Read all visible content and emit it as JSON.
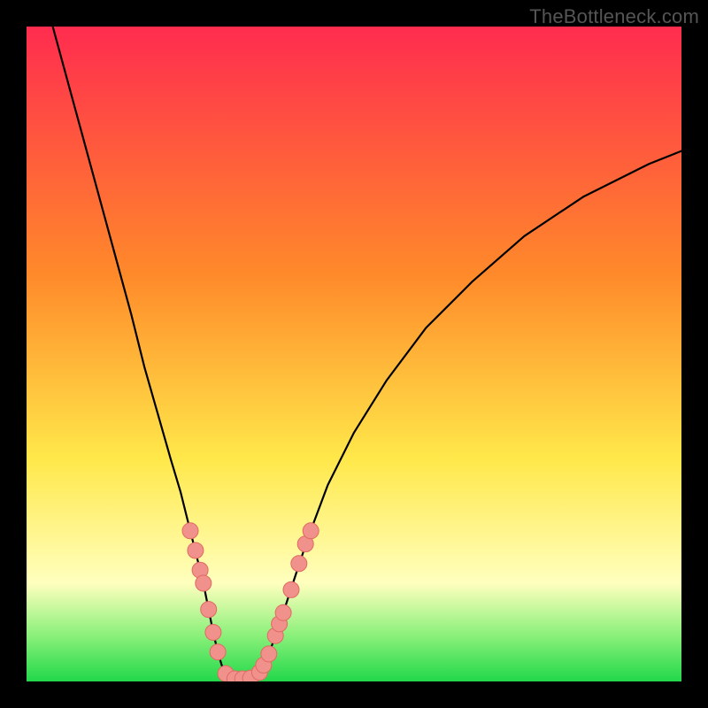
{
  "watermark": "TheBottleneck.com",
  "colors": {
    "gradient_top": "#FF2C4F",
    "gradient_mid1": "#FF8A2A",
    "gradient_mid2": "#FFE84A",
    "gradient_pale": "#FFFFBE",
    "gradient_green_light": "#8AF07A",
    "gradient_green": "#22D84A",
    "curve": "#000000",
    "marker_fill": "#F0918B",
    "marker_stroke": "#E06A63"
  },
  "chart_data": {
    "type": "line",
    "title": "",
    "xlabel": "",
    "ylabel": "",
    "xlim": [
      0,
      100
    ],
    "ylim": [
      0,
      100
    ],
    "series": [
      {
        "name": "curve-left",
        "x": [
          4,
          7,
          10,
          13,
          16,
          18,
          20,
          22,
          23.5,
          25,
          26,
          27,
          27.8,
          28.5,
          29.2,
          29.8,
          30.4
        ],
        "y": [
          100,
          89,
          78,
          67,
          56,
          48,
          41,
          34,
          29,
          23,
          19,
          15,
          11,
          7.5,
          4.5,
          2.5,
          1.2
        ]
      },
      {
        "name": "curve-bottom",
        "x": [
          30.4,
          31,
          31.8,
          32.6,
          33.4,
          34.2,
          35,
          35.6
        ],
        "y": [
          1.2,
          0.6,
          0.4,
          0.4,
          0.4,
          0.5,
          0.8,
          1.4
        ]
      },
      {
        "name": "curve-right",
        "x": [
          35.6,
          36.2,
          37,
          38,
          39.2,
          41,
          43,
          46,
          50,
          55,
          61,
          68,
          76,
          85,
          95,
          100
        ],
        "y": [
          1.4,
          2.5,
          4.2,
          7,
          10.5,
          16,
          22,
          30,
          38,
          46,
          54,
          61,
          68,
          74,
          79,
          81
        ]
      }
    ],
    "markers": [
      {
        "x": 25.0,
        "y": 23.0
      },
      {
        "x": 25.8,
        "y": 20.0
      },
      {
        "x": 26.5,
        "y": 17.0
      },
      {
        "x": 27.0,
        "y": 15.0
      },
      {
        "x": 27.8,
        "y": 11.0
      },
      {
        "x": 28.5,
        "y": 7.5
      },
      {
        "x": 29.2,
        "y": 4.5
      },
      {
        "x": 30.4,
        "y": 1.2
      },
      {
        "x": 31.8,
        "y": 0.4
      },
      {
        "x": 33.0,
        "y": 0.4
      },
      {
        "x": 34.2,
        "y": 0.5
      },
      {
        "x": 35.6,
        "y": 1.4
      },
      {
        "x": 36.2,
        "y": 2.5
      },
      {
        "x": 37.0,
        "y": 4.2
      },
      {
        "x": 38.0,
        "y": 7.0
      },
      {
        "x": 38.6,
        "y": 8.8
      },
      {
        "x": 39.2,
        "y": 10.5
      },
      {
        "x": 40.4,
        "y": 14.0
      },
      {
        "x": 41.6,
        "y": 18.0
      },
      {
        "x": 42.6,
        "y": 21.0
      },
      {
        "x": 43.4,
        "y": 23.0
      }
    ]
  }
}
